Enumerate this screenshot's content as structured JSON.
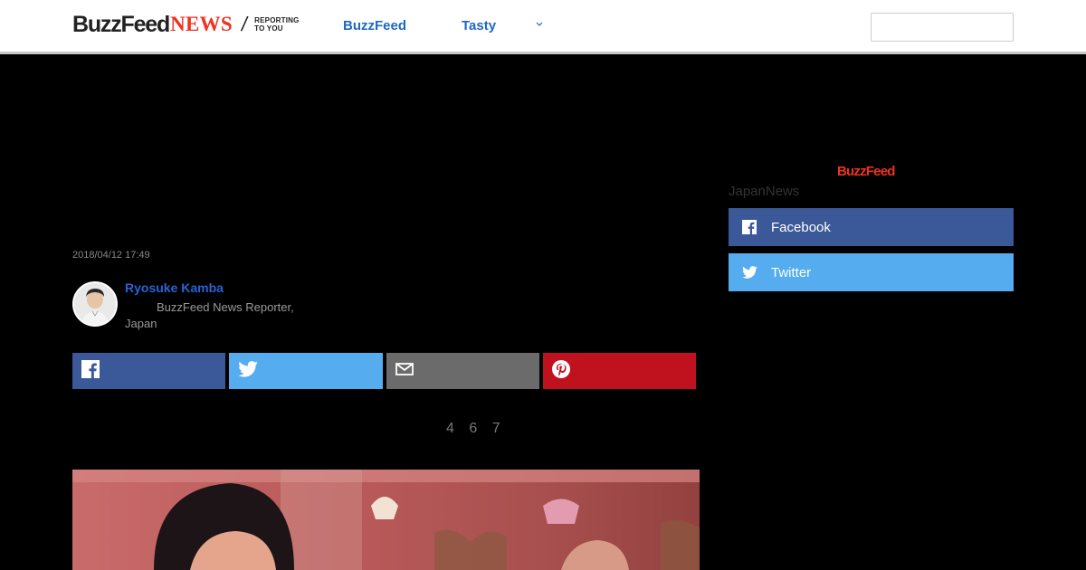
{
  "header": {
    "logo_main": "BuzzFeed",
    "logo_news": "NEWS",
    "logo_tag_line1": "REPORTING",
    "logo_tag_line2": "TO YOU",
    "nav": [
      {
        "label": "BuzzFeed"
      },
      {
        "label": "Tasty"
      }
    ],
    "more_icon": "chevron-down-icon",
    "search_placeholder": ""
  },
  "article": {
    "timestamp": "2018/04/12 17:49",
    "author_name": "Ryosuke Kamba",
    "author_role": "BuzzFeed News Reporter, Japan",
    "share_counts": "4 6   7"
  },
  "share_buttons": [
    {
      "icon": "facebook-icon",
      "color": "#3b5898"
    },
    {
      "icon": "twitter-icon",
      "color": "#55acee"
    },
    {
      "icon": "mail-icon",
      "color": "#6b6b6b"
    },
    {
      "icon": "pinterest-icon",
      "color": "#c0111f"
    }
  ],
  "sidebar": {
    "logo": "BuzzFeed",
    "title": "JapanNews",
    "buttons": [
      {
        "label": "Facebook",
        "icon": "facebook-icon",
        "color": "#3b5898"
      },
      {
        "label": "Twitter",
        "icon": "twitter-icon",
        "color": "#55acee"
      }
    ]
  },
  "colors": {
    "brand_red": "#ee3322",
    "link_blue": "#1f67c6",
    "background": "#000000"
  }
}
